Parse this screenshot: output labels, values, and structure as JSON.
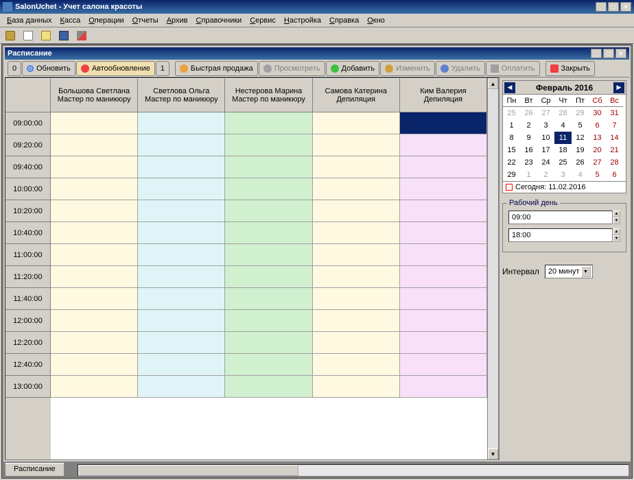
{
  "app": {
    "title": "SalonUchet - Учет салона красоты"
  },
  "menu": [
    "База данных",
    "Касса",
    "Операции",
    "Отчеты",
    "Архив",
    "Справочники",
    "Сервис",
    "Настройка",
    "Справка",
    "Окно"
  ],
  "child": {
    "title": "Расписание",
    "toolbar": {
      "zero": "0",
      "refresh": "Обновить",
      "auto": "Автообновление",
      "one": "1",
      "fast": "Быстрая продажа",
      "view": "Просмотреть",
      "add": "Добавить",
      "edit": "Изменить",
      "delete": "Удалить",
      "pay": "Оплатить",
      "close": "Закрыть"
    }
  },
  "staff": [
    {
      "name": "Большова Светлана",
      "role": "Мастер по маникюру"
    },
    {
      "name": "Светлова Ольга",
      "role": "Мастер по маникюру"
    },
    {
      "name": "Нестерова Марина",
      "role": "Мастер по маникюру"
    },
    {
      "name": "Самова Катерина",
      "role": "Депиляция"
    },
    {
      "name": "Ким Валерия",
      "role": "Депиляция"
    }
  ],
  "times": [
    "09:00:00",
    "09:20:00",
    "09:40:00",
    "10:00:00",
    "10:20:00",
    "10:40:00",
    "11:00:00",
    "11:20:00",
    "11:40:00",
    "12:00:00",
    "12:20:00",
    "12:40:00",
    "13:00:00"
  ],
  "calendar": {
    "title": "Февраль 2016",
    "dow": [
      "Пн",
      "Вт",
      "Ср",
      "Чт",
      "Пт",
      "Сб",
      "Вс"
    ],
    "weeks": [
      [
        {
          "d": 25,
          "o": true
        },
        {
          "d": 26,
          "o": true
        },
        {
          "d": 27,
          "o": true
        },
        {
          "d": 28,
          "o": true
        },
        {
          "d": 29,
          "o": true
        },
        {
          "d": 30,
          "o": true,
          "w": true
        },
        {
          "d": 31,
          "o": true,
          "w": true
        }
      ],
      [
        {
          "d": 1
        },
        {
          "d": 2
        },
        {
          "d": 3
        },
        {
          "d": 4
        },
        {
          "d": 5
        },
        {
          "d": 6,
          "w": true
        },
        {
          "d": 7,
          "w": true
        }
      ],
      [
        {
          "d": 8
        },
        {
          "d": 9
        },
        {
          "d": 10
        },
        {
          "d": 11,
          "sel": true
        },
        {
          "d": 12
        },
        {
          "d": 13,
          "w": true
        },
        {
          "d": 14,
          "w": true
        }
      ],
      [
        {
          "d": 15
        },
        {
          "d": 16
        },
        {
          "d": 17
        },
        {
          "d": 18
        },
        {
          "d": 19
        },
        {
          "d": 20,
          "w": true
        },
        {
          "d": 21,
          "w": true
        }
      ],
      [
        {
          "d": 22
        },
        {
          "d": 23
        },
        {
          "d": 24
        },
        {
          "d": 25
        },
        {
          "d": 26
        },
        {
          "d": 27,
          "w": true
        },
        {
          "d": 28,
          "w": true
        }
      ],
      [
        {
          "d": 29
        },
        {
          "d": 1,
          "o": true
        },
        {
          "d": 2,
          "o": true
        },
        {
          "d": 3,
          "o": true
        },
        {
          "d": 4,
          "o": true
        },
        {
          "d": 5,
          "o": true,
          "w": true
        },
        {
          "d": 6,
          "o": true,
          "w": true
        }
      ]
    ],
    "today_label": "Сегодня: 11.02.2016"
  },
  "workday": {
    "legend": "Рабочий день",
    "start": "09:00",
    "end": "18:00"
  },
  "interval": {
    "label": "Интервал",
    "value": "20 минут"
  },
  "tab": "Расписание"
}
